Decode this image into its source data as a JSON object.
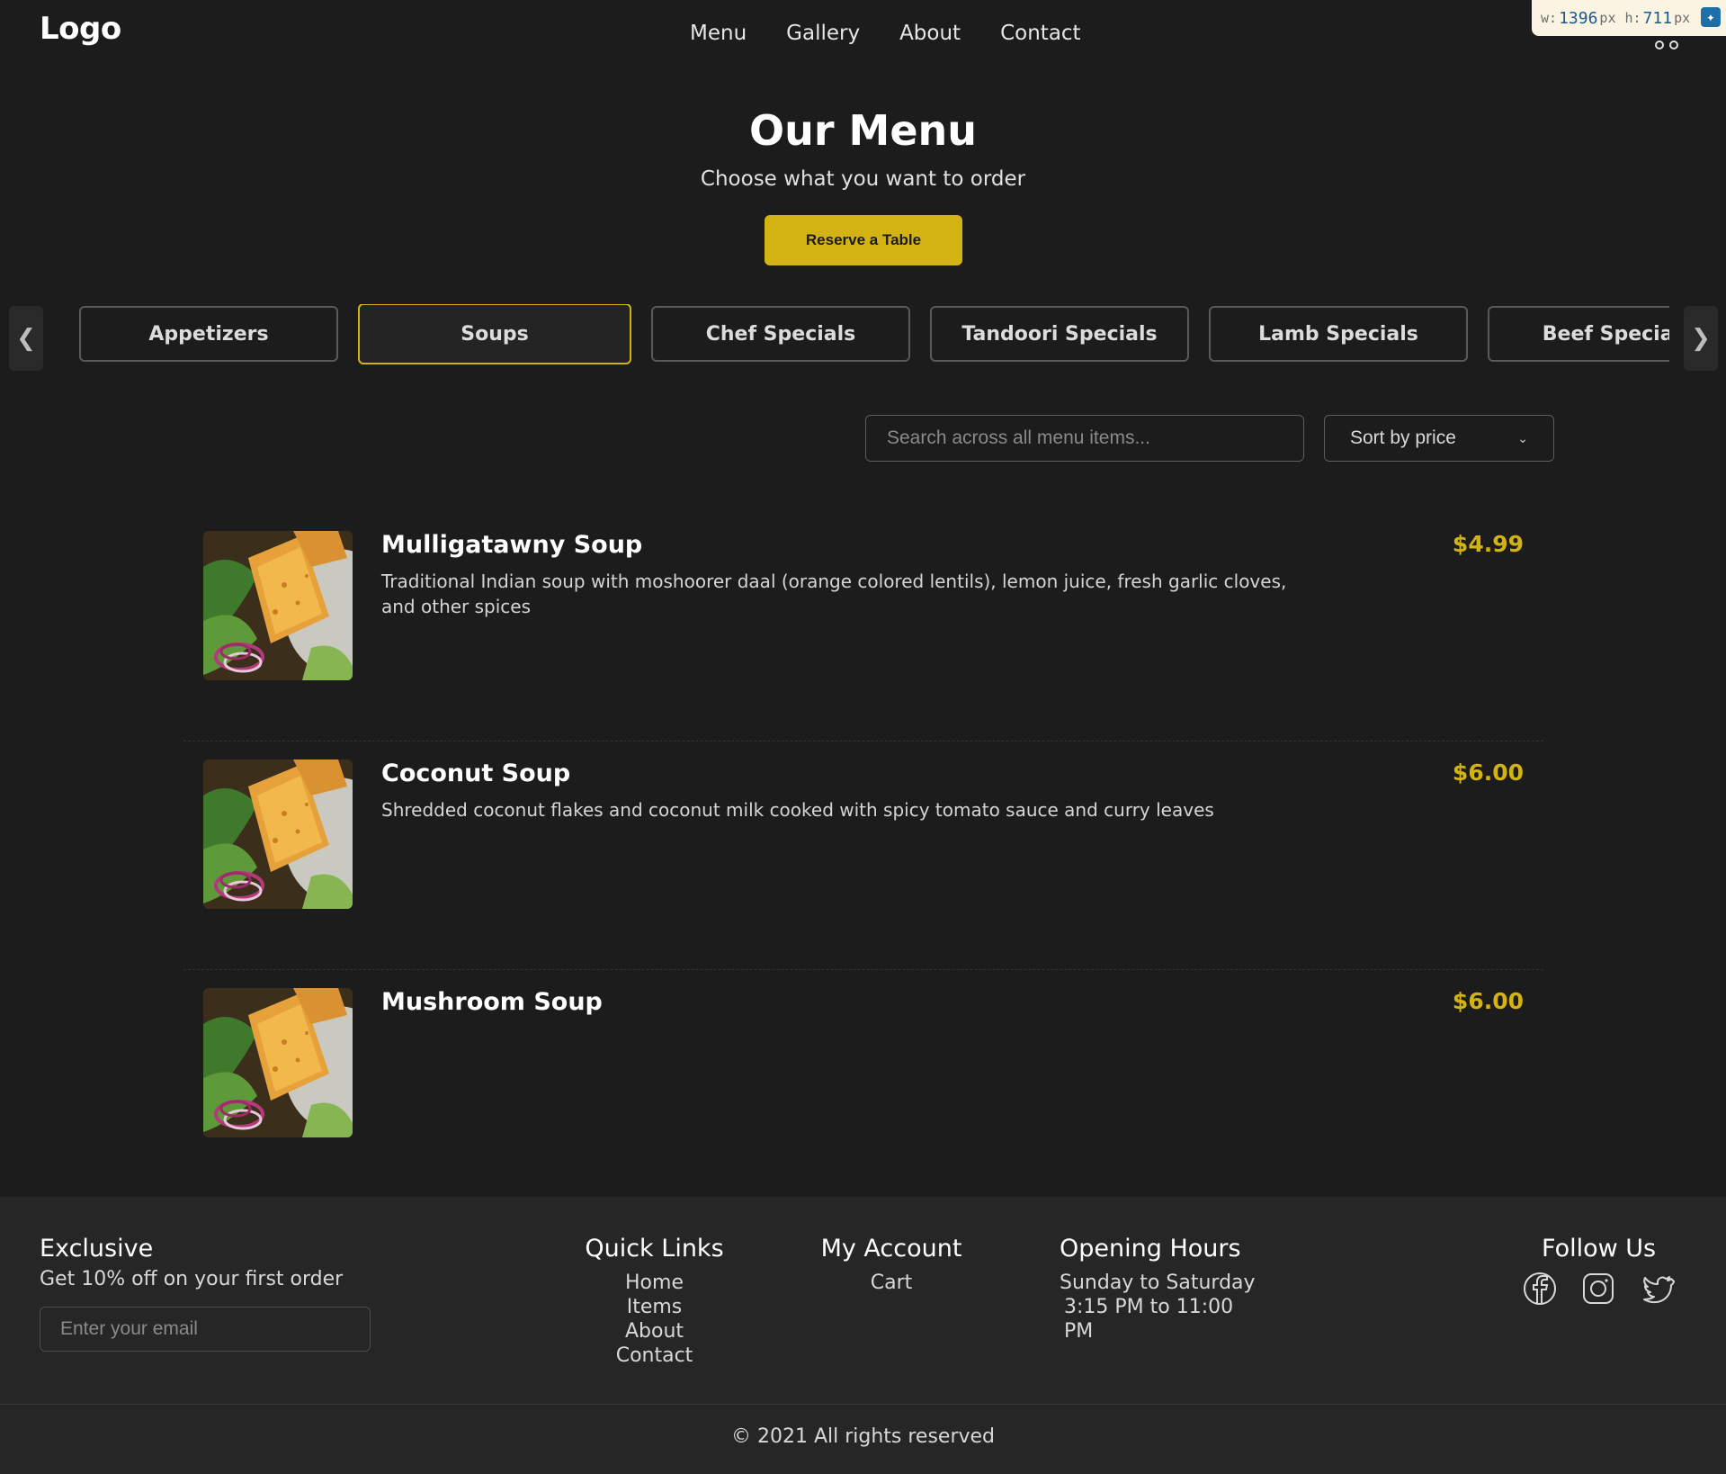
{
  "header": {
    "logo": "Logo",
    "nav": [
      "Menu",
      "Gallery",
      "About",
      "Contact"
    ]
  },
  "size_badge": {
    "w_label": "w:",
    "w": "1396",
    "h_label": "h:",
    "h": "711",
    "unit": "px"
  },
  "hero": {
    "title": "Our Menu",
    "subtitle": "Choose what you want to order",
    "reserve_label": "Reserve a Table"
  },
  "categories": [
    {
      "label": "Appetizers",
      "active": false
    },
    {
      "label": "Soups",
      "active": true
    },
    {
      "label": "Chef Specials",
      "active": false
    },
    {
      "label": "Tandoori Specials",
      "active": false
    },
    {
      "label": "Lamb Specials",
      "active": false
    },
    {
      "label": "Beef Specials",
      "active": false
    }
  ],
  "carousel": {
    "prev": "❮",
    "next": "❯"
  },
  "search": {
    "placeholder": "Search across all menu items..."
  },
  "sort": {
    "selected": "Sort by price"
  },
  "items": [
    {
      "name": "Mulligatawny Soup",
      "description": "Traditional Indian soup with moshoorer daal (orange colored lentils), lemon juice, fresh garlic cloves, and other spices",
      "price": "$4.99"
    },
    {
      "name": "Coconut Soup",
      "description": "Shredded coconut flakes and coconut milk cooked with spicy tomato sauce and curry leaves",
      "price": "$6.00"
    },
    {
      "name": "Mushroom Soup",
      "description": "",
      "price": "$6.00"
    }
  ],
  "footer": {
    "exclusive_title": "Exclusive",
    "exclusive_text": "Get 10% off on your first order",
    "email_placeholder": "Enter your email",
    "quick_links_title": "Quick Links",
    "quick_links": [
      "Home",
      "Items",
      "About",
      "Contact"
    ],
    "account_title": "My Account",
    "account_links": [
      "Cart"
    ],
    "hours_title": "Opening Hours",
    "hours_days": "Sunday to Saturday",
    "hours_time": "3:15 PM to 11:00 PM",
    "follow_title": "Follow Us",
    "social": [
      "facebook-icon",
      "instagram-icon",
      "twitter-icon"
    ],
    "copyright": "© 2021 All rights reserved"
  },
  "colors": {
    "accent": "#d3b314",
    "background": "#1c1c1c",
    "footer": "#262626"
  }
}
